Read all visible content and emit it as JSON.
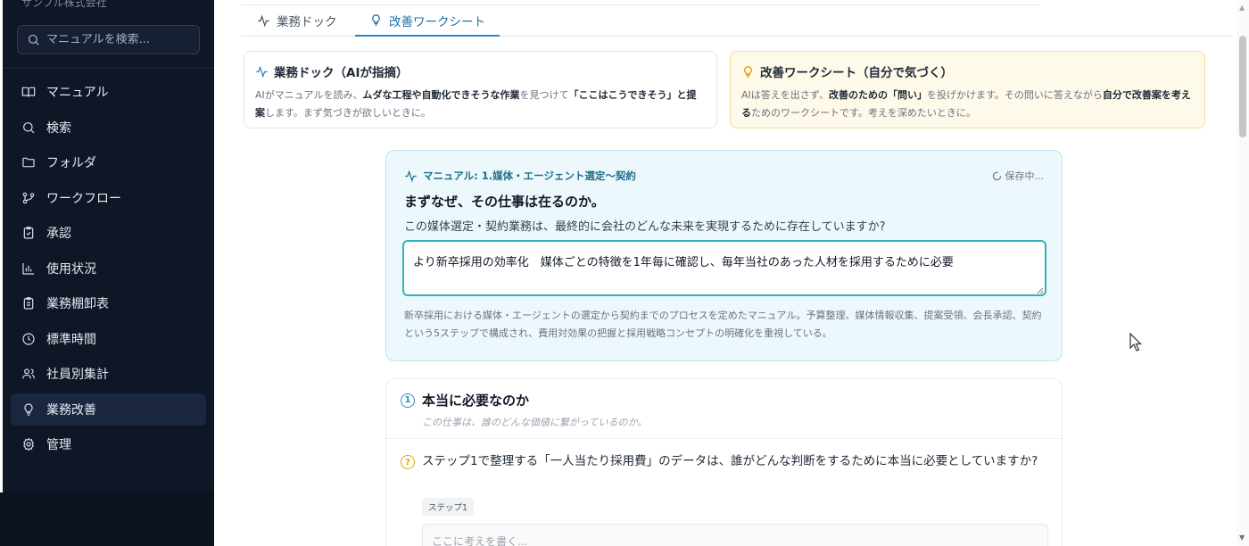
{
  "sidebar": {
    "company": "サンプル株式会社",
    "search_placeholder": "マニュアルを検索...",
    "items": [
      {
        "label": "マニュアル",
        "icon": "book-icon"
      },
      {
        "label": "検索",
        "icon": "search-icon"
      },
      {
        "label": "フォルダ",
        "icon": "folder-icon"
      },
      {
        "label": "ワークフロー",
        "icon": "workflow-icon"
      },
      {
        "label": "承認",
        "icon": "clipboard-check-icon"
      },
      {
        "label": "使用状況",
        "icon": "bar-chart-icon"
      },
      {
        "label": "業務棚卸表",
        "icon": "clipboard-list-icon"
      },
      {
        "label": "標準時間",
        "icon": "clock-icon"
      },
      {
        "label": "社員別集計",
        "icon": "users-icon"
      },
      {
        "label": "業務改善",
        "icon": "lightbulb-icon",
        "active": true
      },
      {
        "label": "管理",
        "icon": "gear-icon"
      }
    ]
  },
  "tabs": [
    {
      "label": "業務ドック",
      "icon": "activity-icon"
    },
    {
      "label": "改善ワークシート",
      "icon": "lightbulb-icon",
      "active": true
    }
  ],
  "modes": {
    "dock": {
      "title": "業務ドック（AIが指摘）",
      "desc_1": "AIがマニュアルを読み、",
      "desc_bold_1": "ムダな工程や自動化できそうな作業",
      "desc_2": "を見つけて",
      "desc_bold_2": "「ここはこうできそう」と提案",
      "desc_3": "します。まず気づきが欲しいときに。"
    },
    "sheet": {
      "title": "改善ワークシート（自分で気づく）",
      "desc_1": "AIは答えを出さず、",
      "desc_bold_1": "改善のための「問い」",
      "desc_2": "を投げかけます。その問いに答えながら",
      "desc_bold_2": "自分で改善案を考える",
      "desc_3": "ためのワークシートです。考えを深めたいときに。"
    }
  },
  "hero": {
    "manual_label": "マニュアル: 1.媒体・エージェント選定〜契約",
    "saving": "保存中...",
    "question": "まずなぜ、その仕事は在るのか。",
    "sub": "この媒体選定・契約業務は、最終的に会社のどんな未来を実現するために存在していますか?",
    "answer": "より新卒採用の効率化　媒体ごとの特徴を1年毎に確認し、毎年当社のあった人材を採用するために必要",
    "note": "新卒採用における媒体・エージェントの選定から契約までのプロセスを定めたマニュアル。予算整理、媒体情報収集、提案受領、会長承認、契約という5ステップで構成され、費用対効果の把握と採用戦略コンセプトの明確化を重視している。"
  },
  "question_card": {
    "number": "1",
    "title": "本当に必要なのか",
    "sub": "この仕事は、誰のどんな価値に繋がっているのか。",
    "question_icon": "?",
    "question": "ステップ1で整理する「一人当たり採用費」のデータは、誰がどんな判断をするために本当に必要としていますか?",
    "step_tag": "ステップ1",
    "input_placeholder": "ここに考えを書く..."
  },
  "colors": {
    "sidebar_bg": "#0f1626",
    "accent": "#2b85c4",
    "hero_bg": "#edf8fc",
    "hero_border_focus": "#2fb3b9",
    "sheet_card_bg": "#fef9e8"
  }
}
